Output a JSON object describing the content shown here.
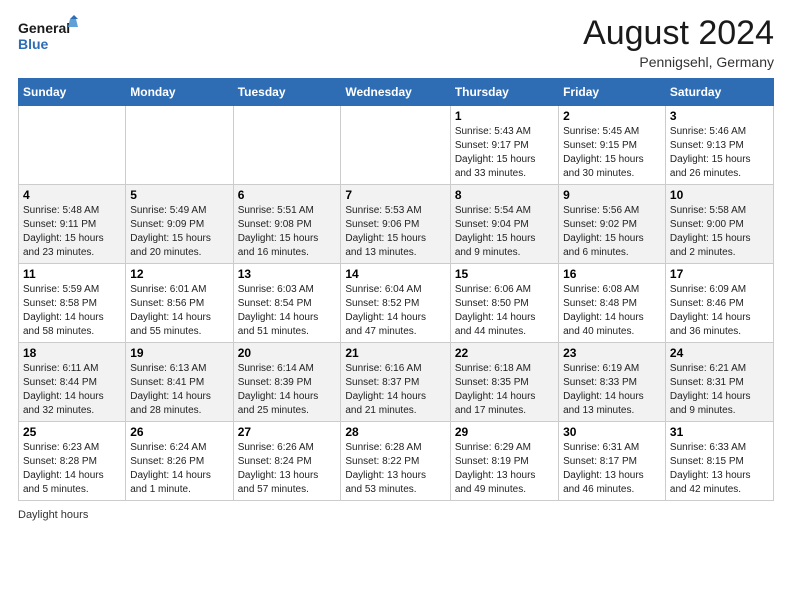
{
  "header": {
    "logo_general": "General",
    "logo_blue": "Blue",
    "month_year": "August 2024",
    "location": "Pennigsehl, Germany"
  },
  "days_of_week": [
    "Sunday",
    "Monday",
    "Tuesday",
    "Wednesday",
    "Thursday",
    "Friday",
    "Saturday"
  ],
  "weeks": [
    [
      {
        "num": "",
        "info": ""
      },
      {
        "num": "",
        "info": ""
      },
      {
        "num": "",
        "info": ""
      },
      {
        "num": "",
        "info": ""
      },
      {
        "num": "1",
        "info": "Sunrise: 5:43 AM\nSunset: 9:17 PM\nDaylight: 15 hours\nand 33 minutes."
      },
      {
        "num": "2",
        "info": "Sunrise: 5:45 AM\nSunset: 9:15 PM\nDaylight: 15 hours\nand 30 minutes."
      },
      {
        "num": "3",
        "info": "Sunrise: 5:46 AM\nSunset: 9:13 PM\nDaylight: 15 hours\nand 26 minutes."
      }
    ],
    [
      {
        "num": "4",
        "info": "Sunrise: 5:48 AM\nSunset: 9:11 PM\nDaylight: 15 hours\nand 23 minutes."
      },
      {
        "num": "5",
        "info": "Sunrise: 5:49 AM\nSunset: 9:09 PM\nDaylight: 15 hours\nand 20 minutes."
      },
      {
        "num": "6",
        "info": "Sunrise: 5:51 AM\nSunset: 9:08 PM\nDaylight: 15 hours\nand 16 minutes."
      },
      {
        "num": "7",
        "info": "Sunrise: 5:53 AM\nSunset: 9:06 PM\nDaylight: 15 hours\nand 13 minutes."
      },
      {
        "num": "8",
        "info": "Sunrise: 5:54 AM\nSunset: 9:04 PM\nDaylight: 15 hours\nand 9 minutes."
      },
      {
        "num": "9",
        "info": "Sunrise: 5:56 AM\nSunset: 9:02 PM\nDaylight: 15 hours\nand 6 minutes."
      },
      {
        "num": "10",
        "info": "Sunrise: 5:58 AM\nSunset: 9:00 PM\nDaylight: 15 hours\nand 2 minutes."
      }
    ],
    [
      {
        "num": "11",
        "info": "Sunrise: 5:59 AM\nSunset: 8:58 PM\nDaylight: 14 hours\nand 58 minutes."
      },
      {
        "num": "12",
        "info": "Sunrise: 6:01 AM\nSunset: 8:56 PM\nDaylight: 14 hours\nand 55 minutes."
      },
      {
        "num": "13",
        "info": "Sunrise: 6:03 AM\nSunset: 8:54 PM\nDaylight: 14 hours\nand 51 minutes."
      },
      {
        "num": "14",
        "info": "Sunrise: 6:04 AM\nSunset: 8:52 PM\nDaylight: 14 hours\nand 47 minutes."
      },
      {
        "num": "15",
        "info": "Sunrise: 6:06 AM\nSunset: 8:50 PM\nDaylight: 14 hours\nand 44 minutes."
      },
      {
        "num": "16",
        "info": "Sunrise: 6:08 AM\nSunset: 8:48 PM\nDaylight: 14 hours\nand 40 minutes."
      },
      {
        "num": "17",
        "info": "Sunrise: 6:09 AM\nSunset: 8:46 PM\nDaylight: 14 hours\nand 36 minutes."
      }
    ],
    [
      {
        "num": "18",
        "info": "Sunrise: 6:11 AM\nSunset: 8:44 PM\nDaylight: 14 hours\nand 32 minutes."
      },
      {
        "num": "19",
        "info": "Sunrise: 6:13 AM\nSunset: 8:41 PM\nDaylight: 14 hours\nand 28 minutes."
      },
      {
        "num": "20",
        "info": "Sunrise: 6:14 AM\nSunset: 8:39 PM\nDaylight: 14 hours\nand 25 minutes."
      },
      {
        "num": "21",
        "info": "Sunrise: 6:16 AM\nSunset: 8:37 PM\nDaylight: 14 hours\nand 21 minutes."
      },
      {
        "num": "22",
        "info": "Sunrise: 6:18 AM\nSunset: 8:35 PM\nDaylight: 14 hours\nand 17 minutes."
      },
      {
        "num": "23",
        "info": "Sunrise: 6:19 AM\nSunset: 8:33 PM\nDaylight: 14 hours\nand 13 minutes."
      },
      {
        "num": "24",
        "info": "Sunrise: 6:21 AM\nSunset: 8:31 PM\nDaylight: 14 hours\nand 9 minutes."
      }
    ],
    [
      {
        "num": "25",
        "info": "Sunrise: 6:23 AM\nSunset: 8:28 PM\nDaylight: 14 hours\nand 5 minutes."
      },
      {
        "num": "26",
        "info": "Sunrise: 6:24 AM\nSunset: 8:26 PM\nDaylight: 14 hours\nand 1 minute."
      },
      {
        "num": "27",
        "info": "Sunrise: 6:26 AM\nSunset: 8:24 PM\nDaylight: 13 hours\nand 57 minutes."
      },
      {
        "num": "28",
        "info": "Sunrise: 6:28 AM\nSunset: 8:22 PM\nDaylight: 13 hours\nand 53 minutes."
      },
      {
        "num": "29",
        "info": "Sunrise: 6:29 AM\nSunset: 8:19 PM\nDaylight: 13 hours\nand 49 minutes."
      },
      {
        "num": "30",
        "info": "Sunrise: 6:31 AM\nSunset: 8:17 PM\nDaylight: 13 hours\nand 46 minutes."
      },
      {
        "num": "31",
        "info": "Sunrise: 6:33 AM\nSunset: 8:15 PM\nDaylight: 13 hours\nand 42 minutes."
      }
    ]
  ],
  "footer": {
    "daylight_label": "Daylight hours"
  }
}
